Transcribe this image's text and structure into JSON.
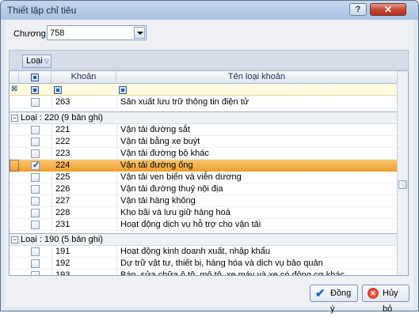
{
  "window": {
    "title": "Thiết lập chỉ tiêu",
    "help_label": "?",
    "close_label": "✕"
  },
  "chuong": {
    "label": "Chương",
    "value": "758"
  },
  "group_panel": {
    "chip_label": "Loại"
  },
  "grid": {
    "columns": [
      "",
      "",
      "Khoản",
      "Tên loại khoản"
    ],
    "row_263": {
      "khoan": "263",
      "ten": "Sản xuất lưu trữ thông tin điện tử"
    },
    "group_220": {
      "label": "Loại : 220 (9 bản ghi)",
      "rows": [
        {
          "khoan": "221",
          "ten": "Vận tải đường sắt",
          "checked": false
        },
        {
          "khoan": "222",
          "ten": "Vận tải bằng xe buýt",
          "checked": false
        },
        {
          "khoan": "223",
          "ten": "Vận tải đường bộ khác",
          "checked": false
        },
        {
          "khoan": "224",
          "ten": "Vận tải đường ống",
          "checked": true
        },
        {
          "khoan": "225",
          "ten": "Vận tải ven biển và viễn dương",
          "checked": false
        },
        {
          "khoan": "226",
          "ten": "Vận tải đường thuỷ nội địa",
          "checked": false
        },
        {
          "khoan": "227",
          "ten": "Vận tải hàng không",
          "checked": false
        },
        {
          "khoan": "228",
          "ten": "Kho bãi và lưu giữ hàng hoá",
          "checked": false
        },
        {
          "khoan": "231",
          "ten": "Hoạt động dịch vụ hỗ trợ cho vận tải",
          "checked": false
        }
      ]
    },
    "group_190": {
      "label": "Loại : 190 (5 bản ghi)",
      "rows": [
        {
          "khoan": "191",
          "ten": "Hoạt động kinh doanh xuất, nhập khẩu",
          "checked": false
        },
        {
          "khoan": "192",
          "ten": "Dự trữ vật tư, thiết bị, hàng hóa và dịch vụ bảo quản",
          "checked": false
        },
        {
          "khoan": "193",
          "ten": "Bán, sửa chữa ô tô, mô tô, xe máy và xe có động cơ khác",
          "checked": false
        }
      ]
    }
  },
  "buttons": {
    "ok_label": "Đồng ý",
    "cancel_label": "Hủy bỏ"
  },
  "colors": {
    "selected_row": "#f2ac44",
    "titlebar": "#b8cde9",
    "close_button": "#c24530"
  }
}
